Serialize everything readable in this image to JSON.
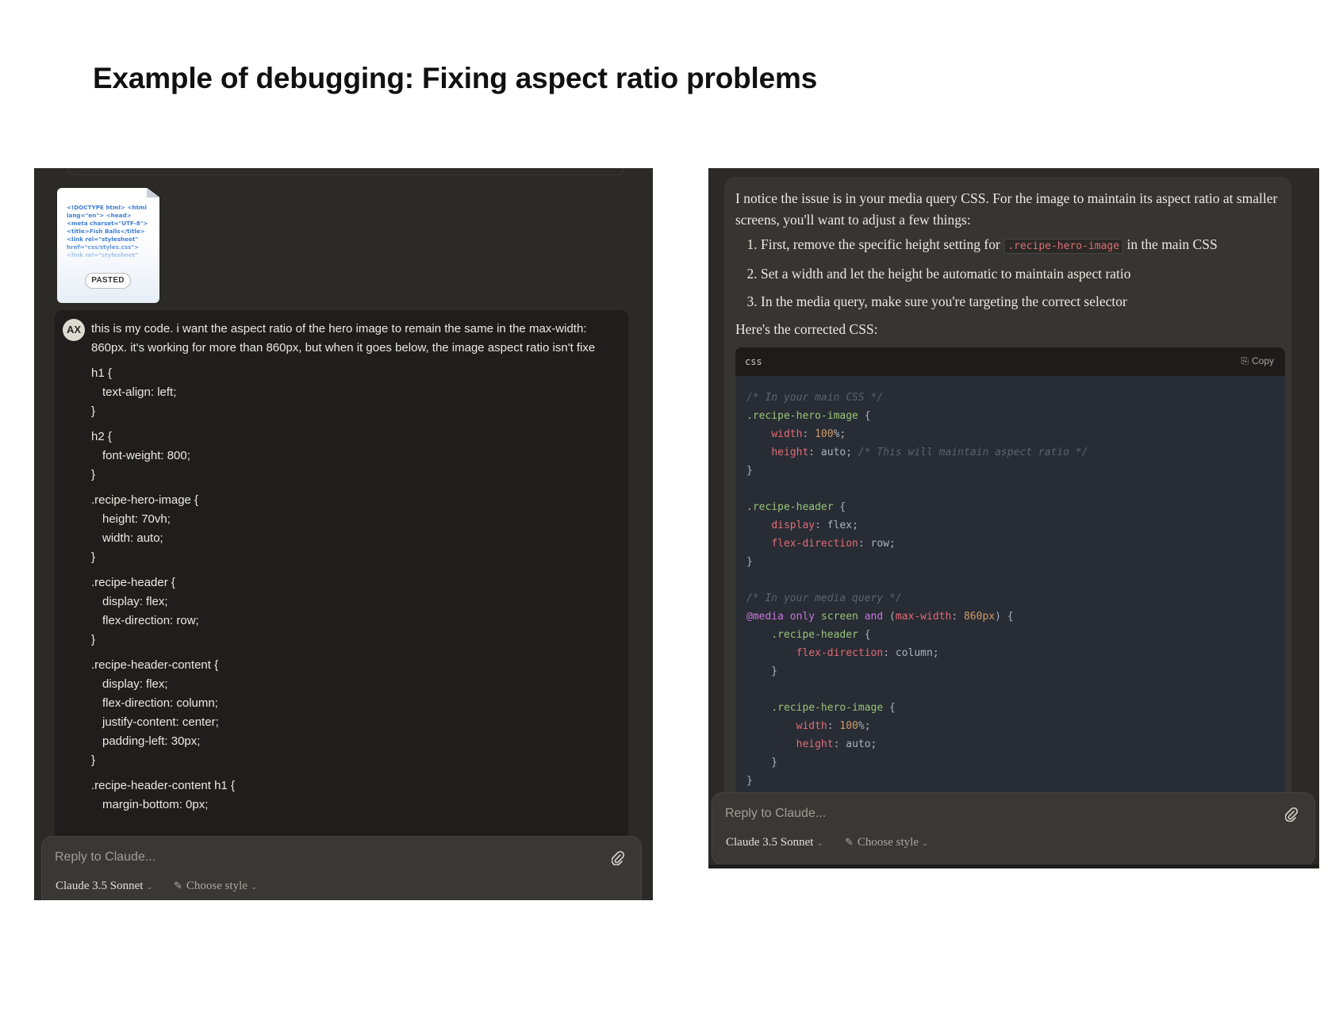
{
  "page": {
    "title": "Example of debugging: Fixing aspect ratio problems"
  },
  "left": {
    "attachment": {
      "preview_text": "<!DOCTYPE html> <html lang=\"en\"> <head> <meta charset=\"UTF-8\"> <title>Fish Balls</title> <link rel=\"stylesheet\" href=\"css/styles.css\"> <link rel=\"stylesheet\"",
      "badge": "PASTED"
    },
    "user": {
      "avatar": "AX",
      "intro": "this is my code. i want the aspect ratio of the hero image to remain the same in the max-width: 860px. it's working for more than 860px, but when it goes below, the image aspect ratio isn't fixe",
      "code_lines": [
        "h1 {",
        "text-align: left;",
        "}",
        "h2 {",
        "font-weight: 800;",
        "}",
        ".recipe-hero-image {",
        "height: 70vh;",
        "width: auto;",
        "}",
        ".recipe-header {",
        "display: flex;",
        "flex-direction: row;",
        "}",
        ".recipe-header-content {",
        "display: flex;",
        "flex-direction: column;",
        "justify-content: center;",
        "padding-left: 30px;",
        "}",
        ".recipe-header-content h1 {",
        "margin-bottom: 0px;"
      ]
    },
    "reply": {
      "placeholder": "Reply to Claude...",
      "model": "Claude 3.5 Sonnet",
      "style": "Choose style"
    }
  },
  "right": {
    "assistant": {
      "intro": "I notice the issue is in your media query CSS. For the image to maintain its aspect ratio at smaller screens, you'll want to adjust a few things:",
      "steps": [
        {
          "before": "First, remove the specific height setting for ",
          "code": ".recipe-hero-image",
          "after": " in the main CSS"
        },
        {
          "before": "Set a width and let the height be automatic to maintain aspect ratio",
          "code": "",
          "after": ""
        },
        {
          "before": "In the media query, make sure you're targeting the correct selector",
          "code": "",
          "after": ""
        }
      ],
      "lead_in": "Here's the corrected CSS:"
    },
    "code_card": {
      "language": "css",
      "copy_label": "Copy",
      "lines": [
        "/* In your main CSS */",
        ".recipe-hero-image {",
        "    width: 100%;",
        "    height: auto; /* This will maintain aspect ratio */",
        "}",
        "",
        ".recipe-header {",
        "    display: flex;",
        "    flex-direction: row;",
        "}",
        "",
        "/* In your media query */",
        "@media only screen and (max-width: 860px) {",
        "    .recipe-header {",
        "        flex-direction: column;",
        "    }",
        "",
        "    .recipe-hero-image {",
        "        width: 100%;",
        "        height: auto;",
        "    }",
        "}"
      ]
    },
    "reply": {
      "placeholder": "Reply to Claude...",
      "model": "Claude 3.5 Sonnet",
      "style": "Choose style"
    }
  },
  "icons": {
    "attach": "paperclip-icon",
    "style": "brush-icon",
    "copy": "clipboard-icon",
    "chevron": "chevron-down-icon"
  },
  "colors": {
    "panel_bg": "#2b2a27",
    "user_msg_bg": "#1f1e1c",
    "assistant_msg_bg": "#363531",
    "code_bg": "#282c34",
    "selector": "#98c379",
    "property": "#e06c75",
    "number": "#d19a66",
    "keyword": "#c678dd",
    "comment": "#5c6370"
  }
}
